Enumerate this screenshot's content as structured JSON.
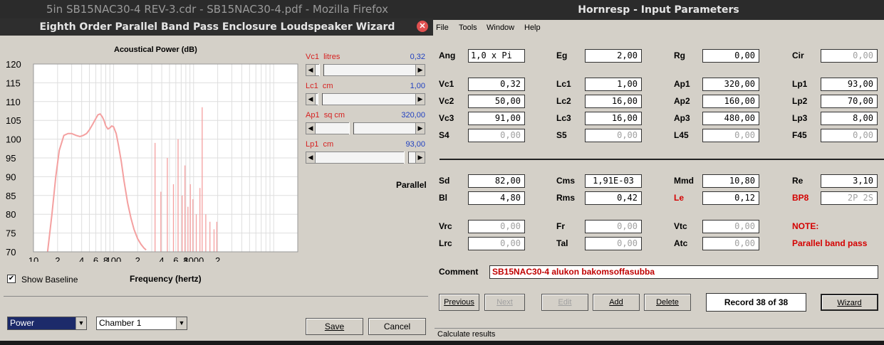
{
  "firefox": {
    "title": "5in SB15NAC30-4 REV-3.cdr - SB15NAC30-4.pdf - Mozilla Firefox"
  },
  "wizard": {
    "title": "Eighth Order Parallel Band Pass Enclosure Loudspeaker Wizard",
    "close_icon": "close-icon",
    "chart_title": "Acoustical Power (dB)",
    "mode_label": "Parallel",
    "show_baseline_label": "Show Baseline",
    "show_baseline_checked": true,
    "freq_label": "Frequency (hertz)",
    "sliders": [
      {
        "name": "Vc1",
        "unit": "litres",
        "value": "0,32",
        "position": 0.04
      },
      {
        "name": "Lc1",
        "unit": "cm",
        "value": "1,00",
        "position": 0.02
      },
      {
        "name": "Ap1",
        "unit": "sq cm",
        "value": "320,00",
        "position": 0.35
      },
      {
        "name": "Lp1",
        "unit": "cm",
        "value": "93,00",
        "position": 0.93
      }
    ],
    "combo1": "Power",
    "combo2": "Chamber 1",
    "save_label": "Save",
    "cancel_label": "Cancel"
  },
  "chart_data": {
    "type": "line",
    "title": "Acoustical Power (dB)",
    "xlabel": "Frequency (hertz)",
    "ylabel": "",
    "xscale": "log",
    "xlim": [
      10,
      20000
    ],
    "ylim": [
      70,
      120
    ],
    "y_ticks": [
      "120",
      "115",
      "110",
      "105",
      "100",
      "95",
      "90",
      "85",
      "80",
      "75",
      "70"
    ],
    "x_tick_labels": [
      "10",
      "2",
      "4",
      "6",
      "8",
      "100",
      "2",
      "4",
      "6",
      "8",
      "1000",
      "2"
    ],
    "grid": true,
    "series": [
      {
        "color": "#f4a0a0",
        "x": [
          15,
          17,
          19,
          21,
          24,
          27,
          30,
          34,
          38,
          42,
          46,
          50,
          55,
          60,
          64,
          68,
          72,
          76,
          80,
          85,
          90,
          95,
          100,
          108,
          115,
          125,
          135,
          150,
          165,
          180,
          200,
          220,
          240,
          255
        ],
        "y": [
          70,
          80,
          90,
          97,
          101,
          101.5,
          101.5,
          101,
          100.7,
          101,
          101.5,
          102.5,
          104,
          105.5,
          106.5,
          106.7,
          106,
          105,
          103.5,
          102.7,
          103,
          103.5,
          103.3,
          101.5,
          98.5,
          94,
          89,
          83,
          79,
          76,
          73.5,
          72,
          71,
          70.5
        ]
      }
    ]
  },
  "hornresp": {
    "title": "Hornresp - Input Parameters",
    "menu": [
      "File",
      "Tools",
      "Window",
      "Help"
    ],
    "rows": [
      [
        {
          "label": "Ang",
          "value": "1,0 x Pi",
          "style": "left"
        },
        {
          "label": "Eg",
          "value": "2,00"
        },
        {
          "label": "Rg",
          "value": "0,00"
        },
        {
          "label": "Cir",
          "value": "0,00",
          "dis": true
        }
      ],
      [
        {
          "label": "Vc1",
          "value": "0,32"
        },
        {
          "label": "Lc1",
          "value": "1,00"
        },
        {
          "label": "Ap1",
          "value": "320,00"
        },
        {
          "label": "Lp1",
          "value": "93,00"
        }
      ],
      [
        {
          "label": "Vc2",
          "value": "50,00"
        },
        {
          "label": "Lc2",
          "value": "16,00"
        },
        {
          "label": "Ap2",
          "value": "160,00"
        },
        {
          "label": "Lp2",
          "value": "70,00"
        }
      ],
      [
        {
          "label": "Vc3",
          "value": "91,00"
        },
        {
          "label": "Lc3",
          "value": "16,00"
        },
        {
          "label": "Ap3",
          "value": "480,00"
        },
        {
          "label": "Lp3",
          "value": "8,00"
        }
      ],
      [
        {
          "label": "S4",
          "value": "0,00",
          "dis": true
        },
        {
          "label": "S5",
          "value": "0,00",
          "dis": true
        },
        {
          "label": "L45",
          "value": "0,00",
          "dis": true
        },
        {
          "label": "F45",
          "value": "0,00",
          "dis": true
        }
      ],
      [
        {
          "label": "Sd",
          "value": "82,00"
        },
        {
          "label": "Cms",
          "value": "1,91E-03",
          "style": "center"
        },
        {
          "label": "Mmd",
          "value": "10,80"
        },
        {
          "label": "Re",
          "value": "3,10"
        }
      ],
      [
        {
          "label": "Bl",
          "value": "4,80"
        },
        {
          "label": "Rms",
          "value": "0,42"
        },
        {
          "label": "Le",
          "value": "0,12",
          "red": true
        },
        {
          "label": "BP8",
          "value": "2P 2S",
          "red": true,
          "dis": true
        }
      ],
      [
        {
          "label": "Vrc",
          "value": "0,00",
          "dis": true
        },
        {
          "label": "Fr",
          "value": "0,00",
          "dis": true
        },
        {
          "label": "Vtc",
          "value": "0,00",
          "dis": true
        }
      ],
      [
        {
          "label": "Lrc",
          "value": "0,00",
          "dis": true
        },
        {
          "label": "Tal",
          "value": "0,00",
          "dis": true
        },
        {
          "label": "Atc",
          "value": "0,00",
          "dis": true
        }
      ]
    ],
    "note_label": "NOTE:",
    "note_text": "Parallel band pass",
    "comment_label": "Comment",
    "comment_value": "SB15NAC30-4 alukon bakomsoffasubba",
    "buttons": {
      "previous": "Previous",
      "next": "Next",
      "edit": "Edit",
      "add": "Add",
      "delete": "Delete",
      "wizard": "Wizard"
    },
    "record": "Record 38 of 38",
    "status": "Calculate results"
  }
}
